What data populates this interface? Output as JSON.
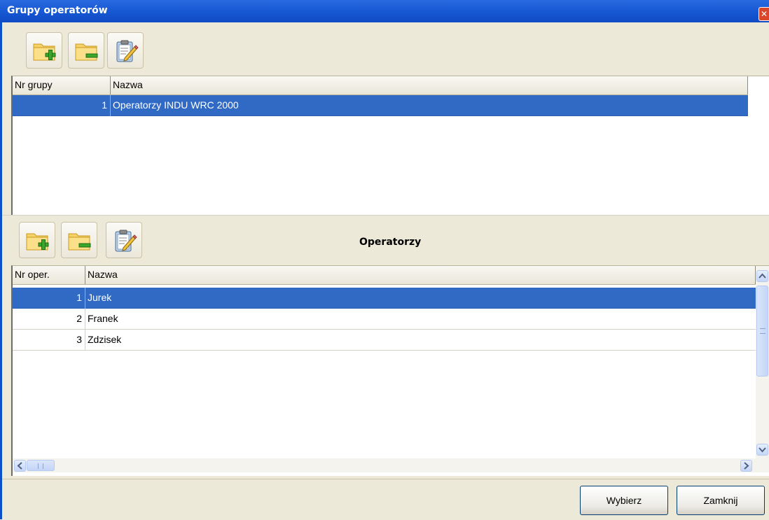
{
  "window": {
    "title": "Grupy operatorów",
    "close_glyph": "✕"
  },
  "toolbar_groups": {
    "buttons": [
      {
        "icon": "folder-add-icon"
      },
      {
        "icon": "folder-remove-icon"
      },
      {
        "icon": "clipboard-edit-icon"
      }
    ]
  },
  "groups_table": {
    "columns": [
      "Nr grupy",
      "Nazwa"
    ],
    "rows": [
      {
        "nr": "1",
        "name": "Operatorzy INDU WRC 2000",
        "selected": true
      }
    ]
  },
  "operators_section": {
    "title": "Operatorzy",
    "buttons": [
      {
        "icon": "folder-add-icon"
      },
      {
        "icon": "folder-remove-icon"
      },
      {
        "icon": "clipboard-edit-icon"
      }
    ]
  },
  "operators_table": {
    "columns": [
      "Nr oper.",
      "Nazwa"
    ],
    "rows": [
      {
        "nr": "1",
        "name": "Jurek",
        "selected": true
      },
      {
        "nr": "2",
        "name": "Franek",
        "selected": false
      },
      {
        "nr": "3",
        "name": "Zdzisek",
        "selected": false
      }
    ]
  },
  "footer": {
    "select_label": "Wybierz",
    "close_label": "Zamknij"
  }
}
